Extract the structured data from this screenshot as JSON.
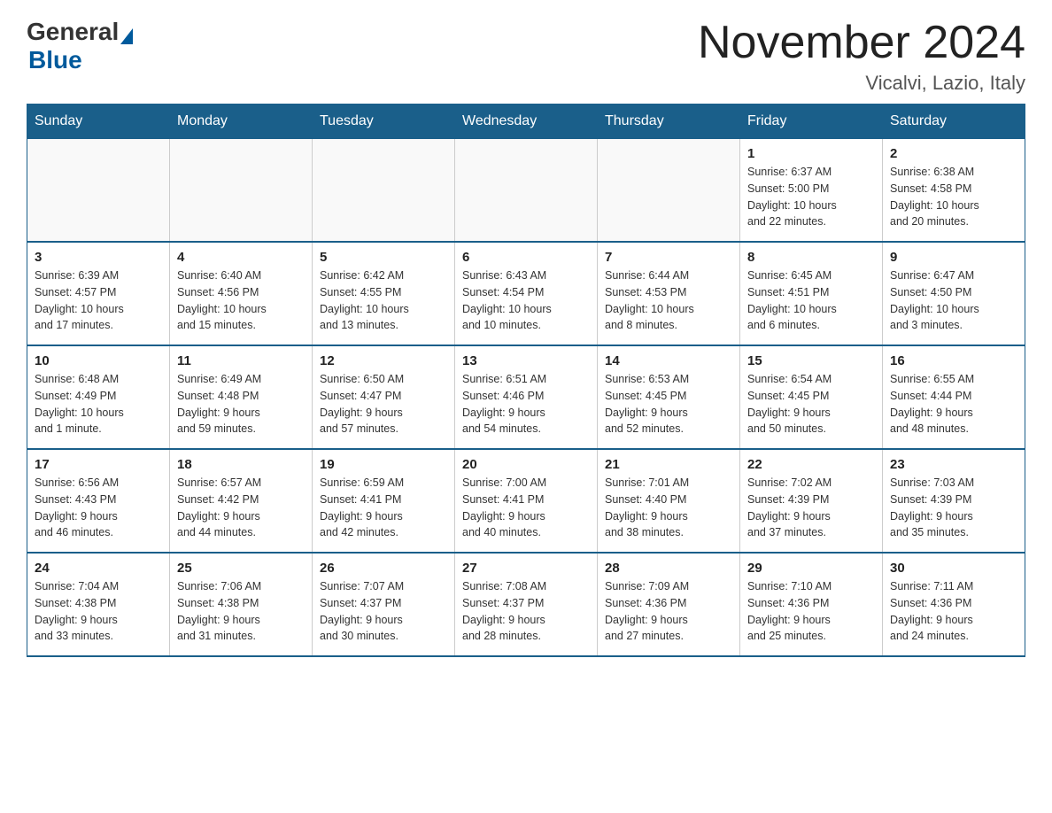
{
  "header": {
    "logo_general": "General",
    "logo_blue": "Blue",
    "month_title": "November 2024",
    "location": "Vicalvi, Lazio, Italy"
  },
  "weekdays": [
    "Sunday",
    "Monday",
    "Tuesday",
    "Wednesday",
    "Thursday",
    "Friday",
    "Saturday"
  ],
  "weeks": [
    {
      "days": [
        {
          "num": "",
          "info": ""
        },
        {
          "num": "",
          "info": ""
        },
        {
          "num": "",
          "info": ""
        },
        {
          "num": "",
          "info": ""
        },
        {
          "num": "",
          "info": ""
        },
        {
          "num": "1",
          "info": "Sunrise: 6:37 AM\nSunset: 5:00 PM\nDaylight: 10 hours\nand 22 minutes."
        },
        {
          "num": "2",
          "info": "Sunrise: 6:38 AM\nSunset: 4:58 PM\nDaylight: 10 hours\nand 20 minutes."
        }
      ]
    },
    {
      "days": [
        {
          "num": "3",
          "info": "Sunrise: 6:39 AM\nSunset: 4:57 PM\nDaylight: 10 hours\nand 17 minutes."
        },
        {
          "num": "4",
          "info": "Sunrise: 6:40 AM\nSunset: 4:56 PM\nDaylight: 10 hours\nand 15 minutes."
        },
        {
          "num": "5",
          "info": "Sunrise: 6:42 AM\nSunset: 4:55 PM\nDaylight: 10 hours\nand 13 minutes."
        },
        {
          "num": "6",
          "info": "Sunrise: 6:43 AM\nSunset: 4:54 PM\nDaylight: 10 hours\nand 10 minutes."
        },
        {
          "num": "7",
          "info": "Sunrise: 6:44 AM\nSunset: 4:53 PM\nDaylight: 10 hours\nand 8 minutes."
        },
        {
          "num": "8",
          "info": "Sunrise: 6:45 AM\nSunset: 4:51 PM\nDaylight: 10 hours\nand 6 minutes."
        },
        {
          "num": "9",
          "info": "Sunrise: 6:47 AM\nSunset: 4:50 PM\nDaylight: 10 hours\nand 3 minutes."
        }
      ]
    },
    {
      "days": [
        {
          "num": "10",
          "info": "Sunrise: 6:48 AM\nSunset: 4:49 PM\nDaylight: 10 hours\nand 1 minute."
        },
        {
          "num": "11",
          "info": "Sunrise: 6:49 AM\nSunset: 4:48 PM\nDaylight: 9 hours\nand 59 minutes."
        },
        {
          "num": "12",
          "info": "Sunrise: 6:50 AM\nSunset: 4:47 PM\nDaylight: 9 hours\nand 57 minutes."
        },
        {
          "num": "13",
          "info": "Sunrise: 6:51 AM\nSunset: 4:46 PM\nDaylight: 9 hours\nand 54 minutes."
        },
        {
          "num": "14",
          "info": "Sunrise: 6:53 AM\nSunset: 4:45 PM\nDaylight: 9 hours\nand 52 minutes."
        },
        {
          "num": "15",
          "info": "Sunrise: 6:54 AM\nSunset: 4:45 PM\nDaylight: 9 hours\nand 50 minutes."
        },
        {
          "num": "16",
          "info": "Sunrise: 6:55 AM\nSunset: 4:44 PM\nDaylight: 9 hours\nand 48 minutes."
        }
      ]
    },
    {
      "days": [
        {
          "num": "17",
          "info": "Sunrise: 6:56 AM\nSunset: 4:43 PM\nDaylight: 9 hours\nand 46 minutes."
        },
        {
          "num": "18",
          "info": "Sunrise: 6:57 AM\nSunset: 4:42 PM\nDaylight: 9 hours\nand 44 minutes."
        },
        {
          "num": "19",
          "info": "Sunrise: 6:59 AM\nSunset: 4:41 PM\nDaylight: 9 hours\nand 42 minutes."
        },
        {
          "num": "20",
          "info": "Sunrise: 7:00 AM\nSunset: 4:41 PM\nDaylight: 9 hours\nand 40 minutes."
        },
        {
          "num": "21",
          "info": "Sunrise: 7:01 AM\nSunset: 4:40 PM\nDaylight: 9 hours\nand 38 minutes."
        },
        {
          "num": "22",
          "info": "Sunrise: 7:02 AM\nSunset: 4:39 PM\nDaylight: 9 hours\nand 37 minutes."
        },
        {
          "num": "23",
          "info": "Sunrise: 7:03 AM\nSunset: 4:39 PM\nDaylight: 9 hours\nand 35 minutes."
        }
      ]
    },
    {
      "days": [
        {
          "num": "24",
          "info": "Sunrise: 7:04 AM\nSunset: 4:38 PM\nDaylight: 9 hours\nand 33 minutes."
        },
        {
          "num": "25",
          "info": "Sunrise: 7:06 AM\nSunset: 4:38 PM\nDaylight: 9 hours\nand 31 minutes."
        },
        {
          "num": "26",
          "info": "Sunrise: 7:07 AM\nSunset: 4:37 PM\nDaylight: 9 hours\nand 30 minutes."
        },
        {
          "num": "27",
          "info": "Sunrise: 7:08 AM\nSunset: 4:37 PM\nDaylight: 9 hours\nand 28 minutes."
        },
        {
          "num": "28",
          "info": "Sunrise: 7:09 AM\nSunset: 4:36 PM\nDaylight: 9 hours\nand 27 minutes."
        },
        {
          "num": "29",
          "info": "Sunrise: 7:10 AM\nSunset: 4:36 PM\nDaylight: 9 hours\nand 25 minutes."
        },
        {
          "num": "30",
          "info": "Sunrise: 7:11 AM\nSunset: 4:36 PM\nDaylight: 9 hours\nand 24 minutes."
        }
      ]
    }
  ]
}
